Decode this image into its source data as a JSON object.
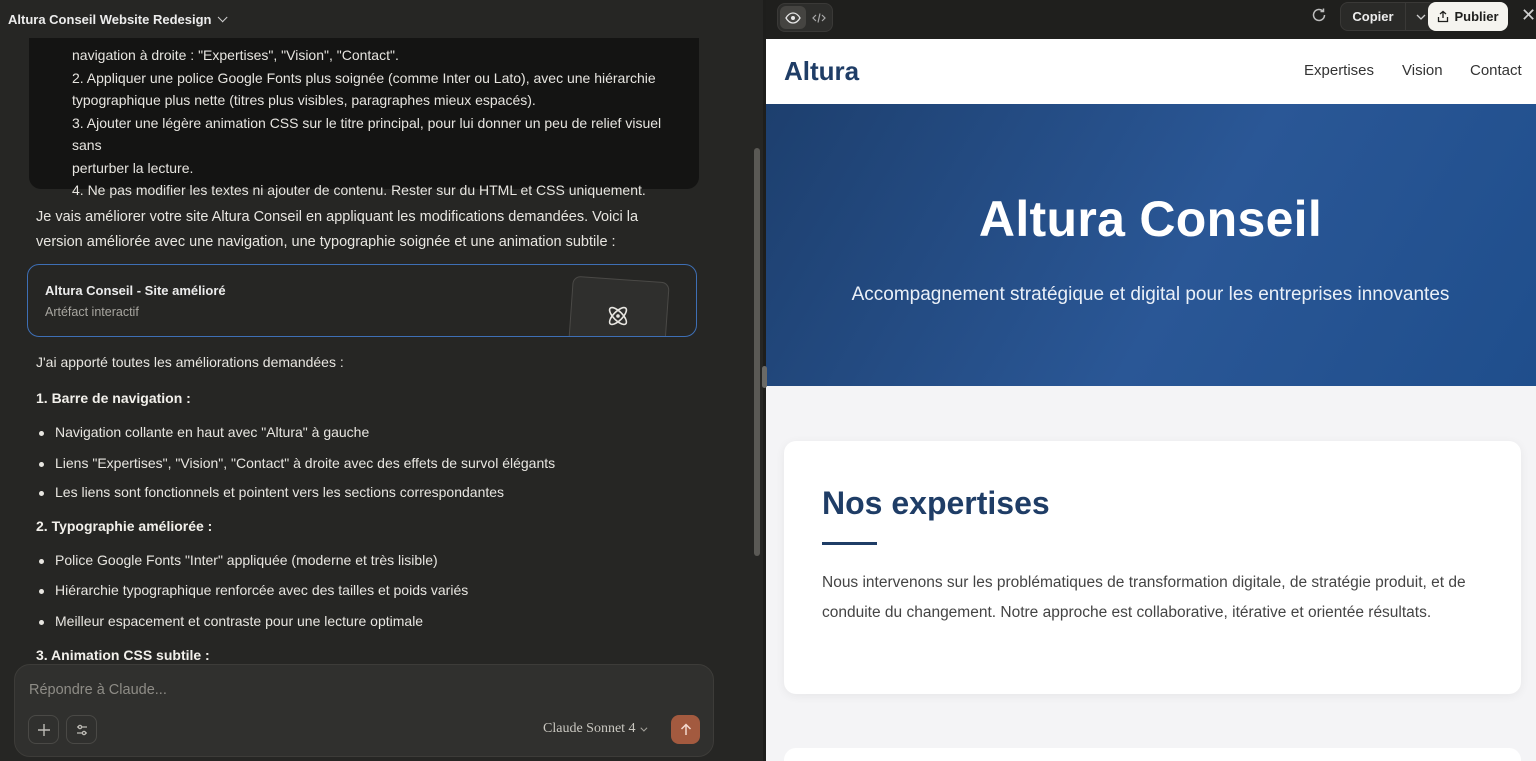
{
  "chat": {
    "title": "Altura Conseil Website Redesign",
    "user_message": {
      "lines": [
        "navigation à droite : \"Expertises\", \"Vision\", \"Contact\".",
        "2. Appliquer une police Google Fonts plus soignée (comme Inter ou Lato), avec une hiérarchie",
        "typographique plus nette (titres plus visibles, paragraphes mieux espacés).",
        "3. Ajouter une légère animation CSS sur le titre principal, pour lui donner un peu de relief visuel sans",
        "perturber la lecture.",
        "4. Ne pas modifier les textes ni ajouter de contenu. Rester sur du HTML et CSS uniquement."
      ]
    },
    "assistant_intro": "Je vais améliorer votre site Altura Conseil en appliquant les modifications demandées. Voici la version améliorée avec une navigation, une typographie soignée et une animation subtile :",
    "artifact": {
      "title": "Altura Conseil - Site amélioré",
      "subtitle": "Artéfact interactif",
      "icon": "atom-icon"
    },
    "reply": {
      "intro": "J'ai apporté toutes les améliorations demandées :",
      "section1": "1. Barre de navigation :",
      "s1_items": [
        "Navigation collante en haut avec \"Altura\" à gauche",
        "Liens \"Expertises\", \"Vision\", \"Contact\" à droite avec des effets de survol élégants",
        "Les liens sont fonctionnels et pointent vers les sections correspondantes"
      ],
      "section2": "2. Typographie améliorée :",
      "s2_items": [
        "Police Google Fonts \"Inter\" appliquée (moderne et très lisible)",
        "Hiérarchie typographique renforcée avec des tailles et poids variés",
        "Meilleur espacement et contraste pour une lecture optimale"
      ],
      "section3": "3. Animation CSS subtile :"
    },
    "composer": {
      "placeholder": "Répondre à Claude...",
      "model": "Claude Sonnet 4"
    },
    "colors": {
      "bg": "#262624",
      "user_bubble": "#141413",
      "send": "#a35a3f",
      "artifact_border": "#3e6fb5"
    }
  },
  "preview_toolbar": {
    "copy_label": "Copier",
    "publish_label": "Publier"
  },
  "site": {
    "logo": "Altura",
    "nav": [
      "Expertises",
      "Vision",
      "Contact"
    ],
    "hero_title": "Altura Conseil",
    "hero_subtitle": "Accompagnement stratégique et digital pour les entreprises innovantes",
    "card_title": "Nos expertises",
    "card_text": "Nous intervenons sur les problématiques de transformation digitale, de stratégie produit, et de conduite du changement. Notre approche est collaborative, itérative et orientée résultats.",
    "colors": {
      "brand": "#1f3d66",
      "hero_start": "#1d3f6e",
      "hero_end": "#2a5796",
      "page_bg": "#f4f4f6"
    }
  }
}
